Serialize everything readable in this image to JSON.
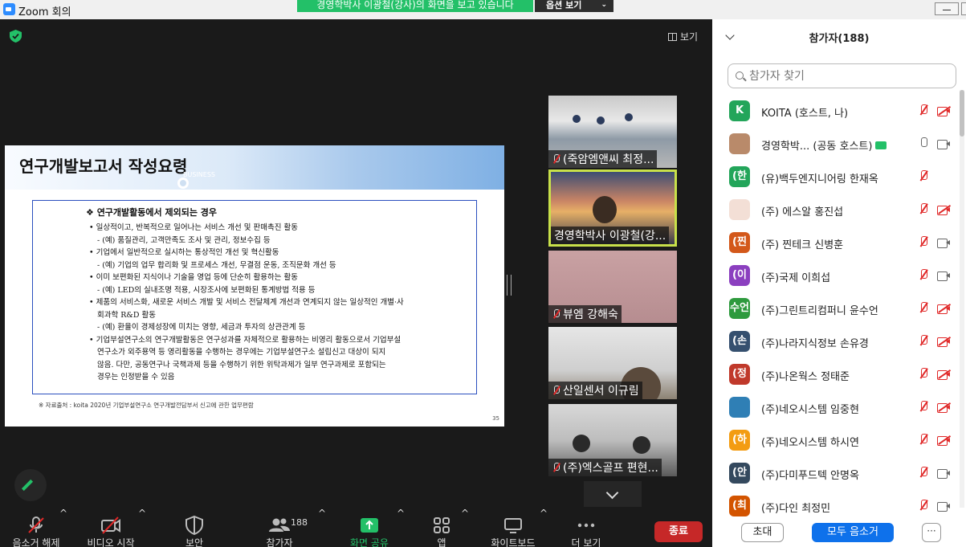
{
  "window": {
    "title": "Zoom 회의"
  },
  "banner": {
    "text": "경영학박사 이광철(강사)의 화면을 보고 있습니다",
    "view_options": "옵션 보기"
  },
  "view_button": "보기",
  "slide": {
    "title": "연구개발보고서 작성요령",
    "deco_text": "BUSINESS",
    "heading": "❖ 연구개발활동에서 제외되는 경우",
    "lines": [
      "• 일상적이고, 반복적으로 일어나는 서비스 개선 및 판매촉진 활동",
      "- (예) 품질관리, 고객만족도 조사 및 관리, 정보수집 등",
      "• 기업에서 일반적으로 실시하는 통상적인 개선 및 혁신활동",
      "- (예) 기업의 업무 합리화 및 프로세스 개선, 무결점 운동, 조직문화 개선 등",
      "• 이미 보편화된 지식이나 기술을 영업 등에 단순히 활용하는 활동",
      "- (예) LED의 실내조명 적용, 시장조사에 보편화된 통계방법 적용 등",
      "• 제품의 서비스화, 새로운 서비스 개발 및 서비스 전달체계 개선과 연계되지 않는 일상적인 개별·사",
      "회과학 R&D 활동",
      "- (예) 환율이 경제성장에 미치는 영향, 세금과 투자의 상관관계 등",
      "• 기업부설연구소의 연구개발활동은 연구성과를 자체적으로 활용하는 비영리 활동으로서 기업부설",
      "연구소가 외주용역 등 영리활동을 수행하는 경우에는 기업부설연구소 설립신고 대상이 되지",
      "않음. 다만, 공동연구나 국책과제 등을 수행하기 위한 위탁과제가 일부 연구과제로 포함되는",
      "경우는 인정받을 수 있음"
    ],
    "source": "※ 자료출처 : koita 2020년 기업부설연구소 연구개발전담부서 신고에 관한 업무편람",
    "page": "35"
  },
  "thumbnails": [
    {
      "name": "(죽암엠앤씨 최정...",
      "muted": true
    },
    {
      "name": "경영학박사 이광철(강...",
      "muted": false,
      "active": true
    },
    {
      "name": "뷰엠 강해숙",
      "muted": true
    },
    {
      "name": "산일센서 이규림",
      "muted": true
    },
    {
      "name": "(주)엑스골프 편현...",
      "muted": true
    }
  ],
  "toolbar": {
    "unmute": "음소거 해제",
    "start_video": "비디오 시작",
    "security": "보안",
    "participants": "참가자",
    "participants_count": "188",
    "share_screen": "화면 공유",
    "apps": "앱",
    "whiteboard": "화이트보드",
    "more": "더 보기",
    "end": "종료"
  },
  "panel": {
    "title": "참가자(188)",
    "search_placeholder": "참가자 찾기",
    "participants": [
      {
        "avatar": "K",
        "color": "#23a55a",
        "name": "KOITA (호스트, 나)",
        "mic": "off",
        "cam": "off"
      },
      {
        "avatar": "",
        "color": "#b98a6a",
        "name": "경영학박...  (공동 호스트)",
        "mic": "on",
        "cam": "on",
        "sharing": true
      },
      {
        "avatar": "(한",
        "color": "#23a55a",
        "name": "(유)백두엔지니어링 한재옥",
        "mic": "off",
        "cam": "none"
      },
      {
        "avatar": "",
        "color": "#f3dfd6",
        "name": "(주) 에스알 홍진섭",
        "mic": "off",
        "cam": "off"
      },
      {
        "avatar": "(찐",
        "color": "#d3581a",
        "name": "(주) 찐테크 신병훈",
        "mic": "off",
        "cam": "on"
      },
      {
        "avatar": "(이",
        "color": "#8b3fbf",
        "name": "(주)국제 이희섭",
        "mic": "off",
        "cam": "on"
      },
      {
        "avatar": "수언",
        "color": "#2e9a3e",
        "name": "(주)그린트리컴퍼니 윤수언",
        "mic": "off",
        "cam": "off"
      },
      {
        "avatar": "(손",
        "color": "#35506f",
        "name": "(주)나라지식정보 손유경",
        "mic": "off",
        "cam": "off"
      },
      {
        "avatar": "(정",
        "color": "#c0392b",
        "name": "(주)나온웍스 정태준",
        "mic": "off",
        "cam": "off"
      },
      {
        "avatar": "",
        "color": "#2f7fb5",
        "name": "(주)네오시스템 임중현",
        "mic": "off",
        "cam": "off"
      },
      {
        "avatar": "(하",
        "color": "#f39c12",
        "name": "(주)네오시스템 하시연",
        "mic": "off",
        "cam": "off"
      },
      {
        "avatar": "(안",
        "color": "#34495e",
        "name": "(주)다미푸드텍 안명옥",
        "mic": "off",
        "cam": "on"
      },
      {
        "avatar": "(최",
        "color": "#d35400",
        "name": "(주)다인 최정민",
        "mic": "off",
        "cam": "on"
      }
    ],
    "invite": "초대",
    "mute_all": "모두 음소거",
    "more": "···"
  }
}
